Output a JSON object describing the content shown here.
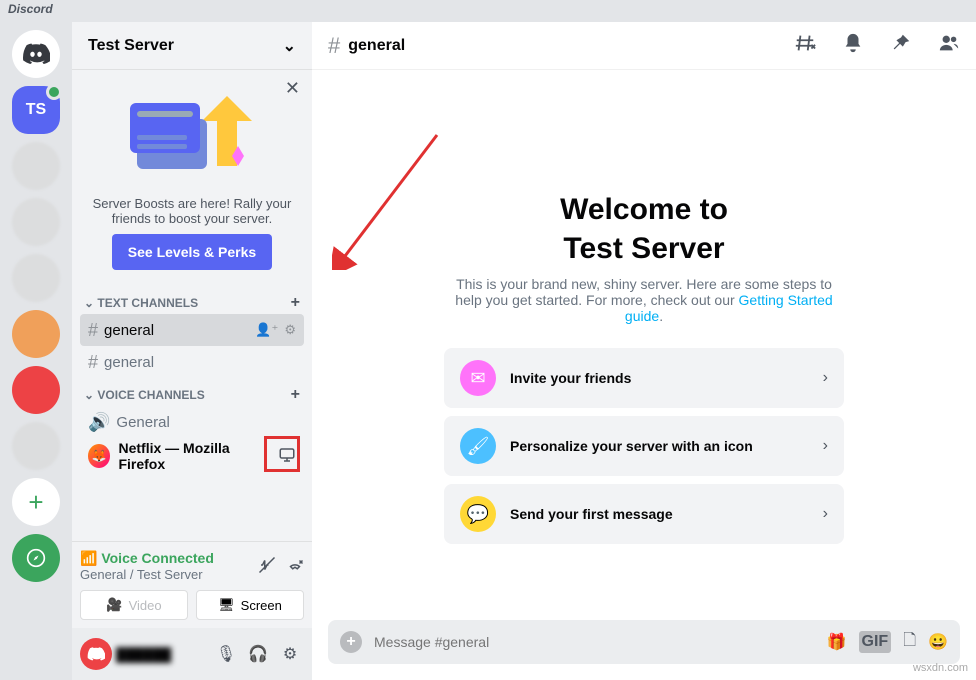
{
  "titlebar": "Discord",
  "server": {
    "name": "Test Server",
    "abbrev": "TS"
  },
  "boost": {
    "text": "Server Boosts are here! Rally your friends to boost your server.",
    "button": "See Levels & Perks"
  },
  "categories": {
    "text": {
      "label": "Text Channels"
    },
    "voice": {
      "label": "Voice Channels"
    }
  },
  "textChannels": [
    {
      "name": "general"
    },
    {
      "name": "general"
    }
  ],
  "voiceChannels": [
    {
      "name": "General"
    }
  ],
  "activity": {
    "title": "Netflix — Mozilla Firefox"
  },
  "voicePanel": {
    "status": "Voice Connected",
    "sub": "General / Test Server",
    "videoBtn": "Video",
    "screenBtn": "Screen"
  },
  "channelHeader": {
    "name": "general"
  },
  "welcome": {
    "title_l1": "Welcome to",
    "title_l2": "Test Server",
    "desc": "This is your brand new, shiny server. Here are some steps to help you get started. For more, check out our ",
    "link": "Getting Started guide"
  },
  "cards": [
    {
      "label": "Invite your friends"
    },
    {
      "label": "Personalize your server with an icon"
    },
    {
      "label": "Send your first message"
    }
  ],
  "compose": {
    "placeholder": "Message #general"
  },
  "gif": "GIF",
  "watermark": "wsxdn.com"
}
